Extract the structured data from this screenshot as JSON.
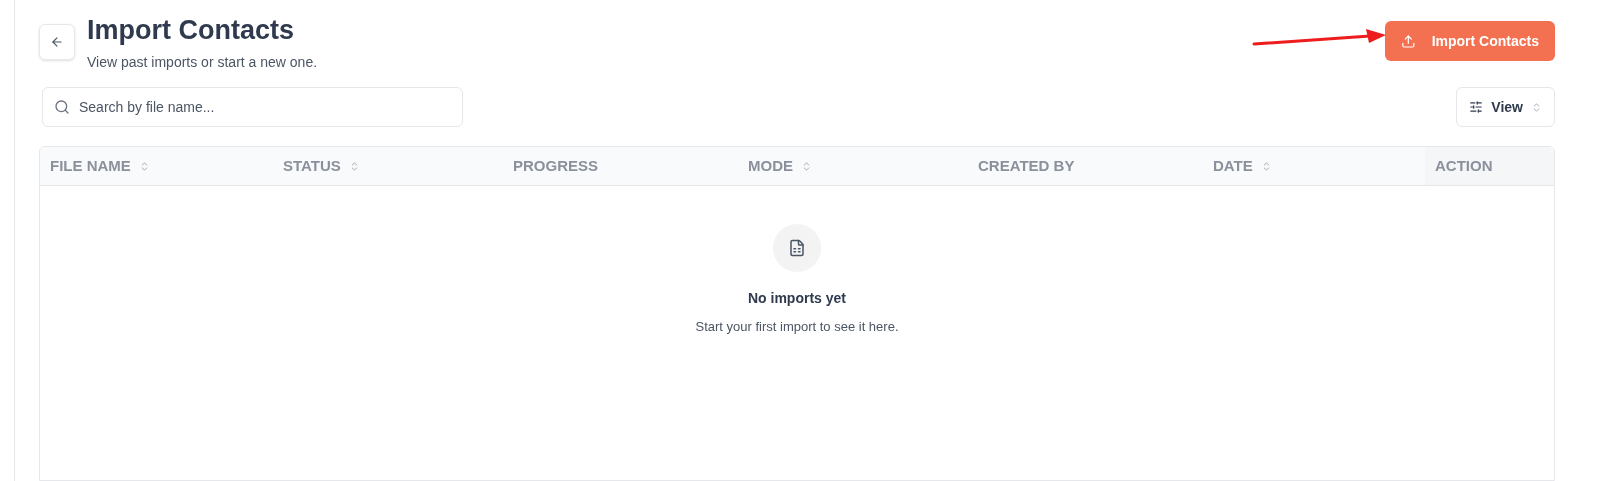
{
  "header": {
    "title": "Import Contacts",
    "subtitle": "View past imports or start a new one."
  },
  "primary_button": {
    "label": "Import Contacts"
  },
  "search": {
    "placeholder": "Search by file name..."
  },
  "view_button": {
    "label": "View"
  },
  "table": {
    "columns": [
      {
        "label": "FILE NAME",
        "sortable": true
      },
      {
        "label": "STATUS",
        "sortable": true
      },
      {
        "label": "PROGRESS",
        "sortable": false
      },
      {
        "label": "MODE",
        "sortable": true
      },
      {
        "label": "CREATED BY",
        "sortable": false
      },
      {
        "label": "DATE",
        "sortable": true
      },
      {
        "label": "ACTION",
        "sortable": false
      }
    ]
  },
  "empty_state": {
    "title": "No imports yet",
    "message": "Start your first import to see it here."
  }
}
